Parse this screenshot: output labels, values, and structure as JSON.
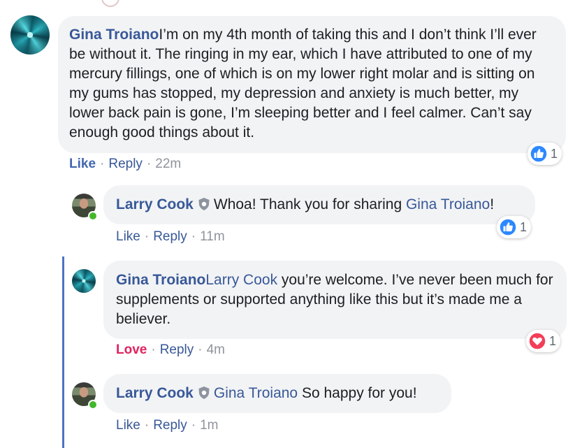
{
  "comments": [
    {
      "author": "Gina Troiano",
      "text": "I’m on my 4th month of taking this and I don’t think I’ll ever be without it. The ringing in my ear, which I have attributed to one of my mercury fillings, one of which is on my lower right molar and is sitting on my gums has stopped, my depression and anxiety is much better, my lower back pain is gone, I’m sleeping better and I feel calmer. Can’t say enough good things about it.",
      "action_like": "Like",
      "action_reply": "Reply",
      "time": "22m",
      "reaction": {
        "type": "like-icon",
        "count": "1"
      }
    },
    {
      "author": "Larry Cook",
      "mention": "Gina Troiano",
      "text_before": "Whoa! Thank you for sharing ",
      "text_after": "!",
      "action_like": "Like",
      "action_reply": "Reply",
      "time": "11m",
      "reaction": {
        "type": "like-icon",
        "count": "1"
      }
    },
    {
      "author": "Gina Troiano",
      "mention": "Larry Cook",
      "text": " you’re welcome. I’ve never been much for supplements or supported anything like this but it’s made me a believer.",
      "action_love": "Love",
      "action_reply": "Reply",
      "time": "4m",
      "reaction": {
        "type": "love-icon",
        "count": "1"
      }
    },
    {
      "author": "Larry Cook",
      "mention": "Gina Troiano",
      "text": " So happy for you!",
      "action_like": "Like",
      "action_reply": "Reply",
      "time": "1m"
    }
  ],
  "separator": "·",
  "colors": {
    "name": "#385898",
    "bubble": "#f2f3f5",
    "like_blue": "#4267b2",
    "love_red": "#e0245e",
    "thread_line": "#4b74c4",
    "online": "#42b72a"
  }
}
